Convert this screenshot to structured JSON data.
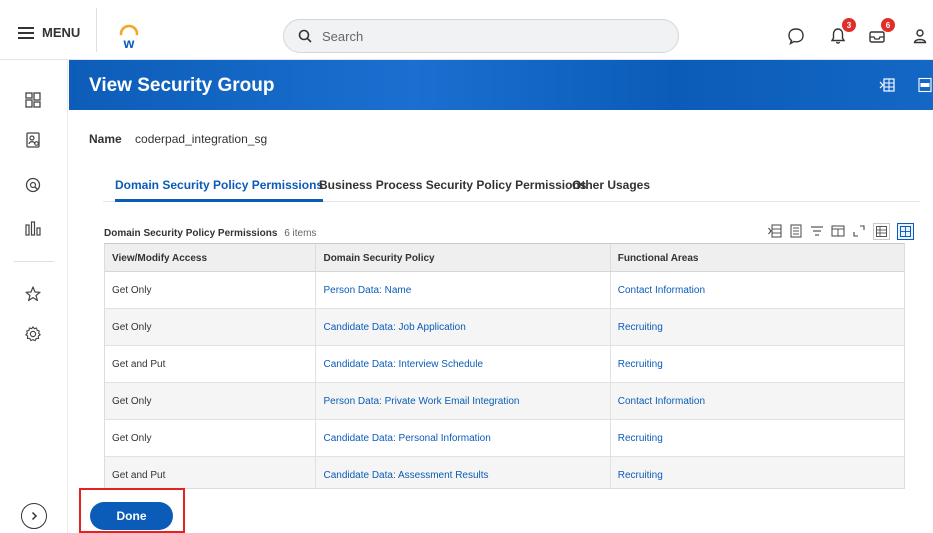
{
  "topbar": {
    "menu_label": "MENU",
    "search_placeholder": "Search",
    "notifications_count": "3",
    "inbox_count": "6"
  },
  "header": {
    "title": "View Security Group"
  },
  "name_field": {
    "label": "Name",
    "value": "coderpad_integration_sg"
  },
  "tabs": [
    {
      "label": "Domain Security Policy Permissions",
      "active": true
    },
    {
      "label": "Business Process Security Policy Permissions",
      "active": false
    },
    {
      "label": "Other Usages",
      "active": false
    }
  ],
  "grid": {
    "title": "Domain Security Policy Permissions",
    "count": "6 items",
    "columns": [
      "View/Modify Access",
      "Domain Security Policy",
      "Functional Areas"
    ],
    "rows": [
      [
        "Get Only",
        "Person Data: Name",
        "Contact Information"
      ],
      [
        "Get Only",
        "Candidate Data: Job Application",
        "Recruiting"
      ],
      [
        "Get and Put",
        "Candidate Data: Interview Schedule",
        "Recruiting"
      ],
      [
        "Get Only",
        "Person Data: Private Work Email Integration",
        "Contact Information"
      ],
      [
        "Get Only",
        "Candidate Data: Personal Information",
        "Recruiting"
      ],
      [
        "Get and Put",
        "Candidate Data: Assessment Results",
        "Recruiting"
      ]
    ]
  },
  "footer": {
    "done_label": "Done"
  },
  "colors": {
    "accent": "#0b5cb8",
    "badge": "#de2f28",
    "highlight": "#e32222"
  }
}
